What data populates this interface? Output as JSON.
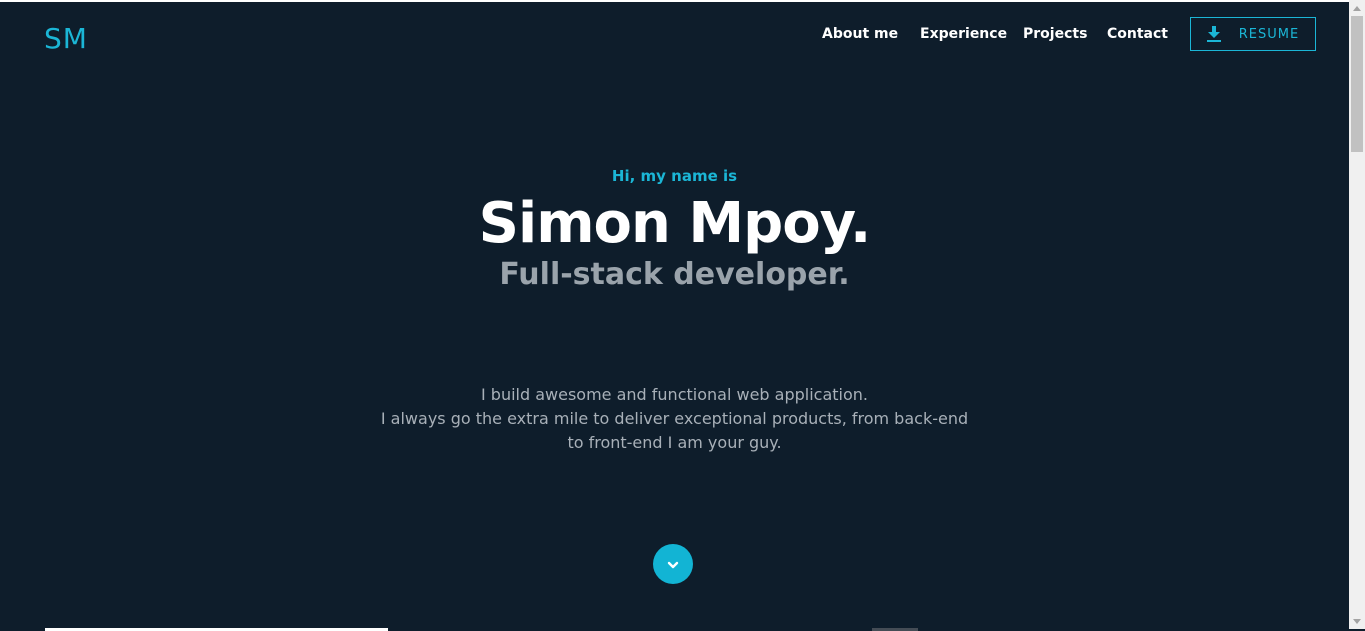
{
  "header": {
    "logo": "SM",
    "nav": [
      {
        "label": "About me"
      },
      {
        "label": "Experience"
      },
      {
        "label": "Projects"
      },
      {
        "label": "Contact"
      }
    ],
    "resume_label": "RESUME"
  },
  "hero": {
    "greeting": "Hi, my name is",
    "name": "Simon Mpoy.",
    "role": "Full-stack developer.",
    "description": [
      "I build awesome and functional web application.",
      "I always go the extra mile to deliver exceptional products, from back-end",
      "to front-end I am your guy."
    ]
  },
  "icons": {
    "resume": "download-icon",
    "scroll": "chevron-down-icon"
  },
  "colors": {
    "background": "#0e1d2b",
    "accent": "#1bb6d6",
    "name": "#ffffff",
    "role": "#9aa3ab",
    "text": "#a8b0b8"
  }
}
